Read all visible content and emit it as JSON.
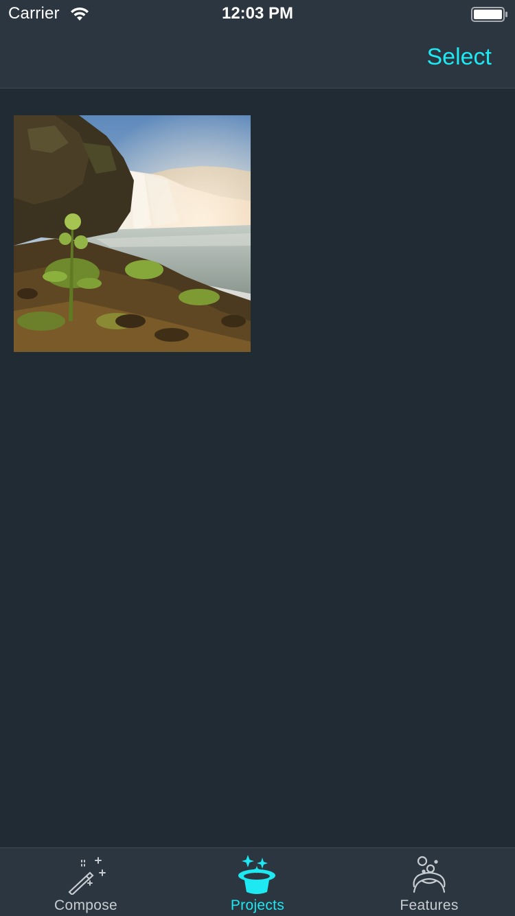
{
  "status_bar": {
    "carrier": "Carrier",
    "time": "12:03 PM",
    "icons": [
      "wifi-icon",
      "battery-icon"
    ]
  },
  "nav_bar": {
    "select_label": "Select"
  },
  "projects": [
    {
      "thumbnail_icon": "waterfall-landscape-image"
    }
  ],
  "tab_bar": {
    "tabs": [
      {
        "label": "Compose",
        "icon": "magic-wand-icon",
        "selected": false
      },
      {
        "label": "Projects",
        "icon": "magic-hat-icon",
        "selected": true
      },
      {
        "label": "Features",
        "icon": "features-icon",
        "selected": false
      }
    ]
  },
  "colors": {
    "accent": "#1ee8f2",
    "background": "#212b34",
    "bar_background": "#2c3640",
    "inactive_tab": "#c8cdd2"
  }
}
